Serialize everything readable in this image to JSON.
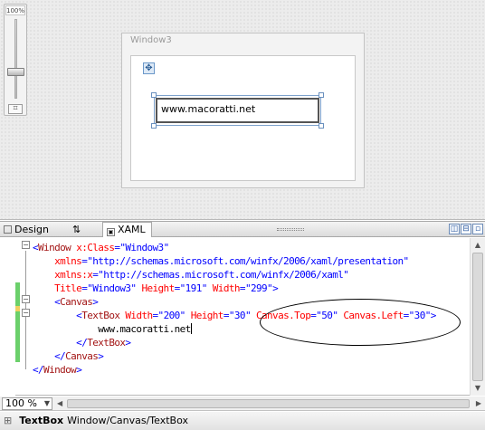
{
  "designer": {
    "zoom_label": "100%",
    "fit_glyph": "⌗",
    "window_title": "Window3",
    "move_glyph": "✥",
    "textbox_text": "www.macoratti.net"
  },
  "tabs": {
    "design_label": "Design",
    "swap_glyph": "⇅",
    "xaml_label": "XAML",
    "xaml_icon": "xaml-file-icon"
  },
  "pane_buttons": {
    "split_vertical": "◫",
    "split_horizontal": "⊟",
    "collapse": "▫"
  },
  "code_lines": [
    [
      {
        "c": "c-br",
        "t": "<"
      },
      {
        "c": "c-el",
        "t": "Window"
      },
      {
        "c": "c-at",
        "t": " x:Class"
      },
      {
        "c": "c-br",
        "t": "="
      },
      {
        "c": "c-vl",
        "t": "\"Window3\""
      }
    ],
    [
      {
        "c": "c-at",
        "t": "    xmlns"
      },
      {
        "c": "c-br",
        "t": "="
      },
      {
        "c": "c-vl",
        "t": "\"http://schemas.microsoft.com/winfx/2006/xaml/presentation\""
      }
    ],
    [
      {
        "c": "c-at",
        "t": "    xmlns:x"
      },
      {
        "c": "c-br",
        "t": "="
      },
      {
        "c": "c-vl",
        "t": "\"http://schemas.microsoft.com/winfx/2006/xaml\""
      }
    ],
    [
      {
        "c": "c-at",
        "t": "    Title"
      },
      {
        "c": "c-br",
        "t": "="
      },
      {
        "c": "c-vl",
        "t": "\"Window3\""
      },
      {
        "c": "c-at",
        "t": " Height"
      },
      {
        "c": "c-br",
        "t": "="
      },
      {
        "c": "c-vl",
        "t": "\"191\""
      },
      {
        "c": "c-at",
        "t": " Width"
      },
      {
        "c": "c-br",
        "t": "="
      },
      {
        "c": "c-vl",
        "t": "\"299\""
      },
      {
        "c": "c-br",
        "t": ">"
      }
    ],
    [
      {
        "c": "c-br",
        "t": "    <"
      },
      {
        "c": "c-el",
        "t": "Canvas"
      },
      {
        "c": "c-br",
        "t": ">"
      }
    ],
    [
      {
        "c": "c-br",
        "t": "        <"
      },
      {
        "c": "c-el",
        "t": "TextBox"
      },
      {
        "c": "c-at",
        "t": " Width"
      },
      {
        "c": "c-br",
        "t": "="
      },
      {
        "c": "c-vl",
        "t": "\"200\""
      },
      {
        "c": "c-at",
        "t": " Height"
      },
      {
        "c": "c-br",
        "t": "="
      },
      {
        "c": "c-vl",
        "t": "\"30\""
      },
      {
        "c": "c-at",
        "t": " Canvas.Top"
      },
      {
        "c": "c-br",
        "t": "="
      },
      {
        "c": "c-vl",
        "t": "\"50\""
      },
      {
        "c": "c-at",
        "t": " Canvas.Left"
      },
      {
        "c": "c-br",
        "t": "="
      },
      {
        "c": "c-vl",
        "t": "\"30\""
      },
      {
        "c": "c-br",
        "t": ">"
      }
    ],
    [
      {
        "c": "c-tx",
        "t": "            www.macoratti.net"
      }
    ],
    [
      {
        "c": "c-br",
        "t": "        </"
      },
      {
        "c": "c-el",
        "t": "TextBox"
      },
      {
        "c": "c-br",
        "t": ">"
      }
    ],
    [
      {
        "c": "c-br",
        "t": "    </"
      },
      {
        "c": "c-el",
        "t": "Canvas"
      },
      {
        "c": "c-br",
        "t": ">"
      }
    ],
    [
      {
        "c": "c-br",
        "t": "</"
      },
      {
        "c": "c-el",
        "t": "Window"
      },
      {
        "c": "c-br",
        "t": ">"
      }
    ]
  ],
  "scroll": {
    "up": "▲",
    "down": "▼",
    "left": "◀",
    "right": "▶"
  },
  "zoom": {
    "value": "100 %",
    "dropdown": "▼"
  },
  "status": {
    "grip": "⊞",
    "current": "TextBox",
    "path": "Window/Canvas/TextBox"
  }
}
